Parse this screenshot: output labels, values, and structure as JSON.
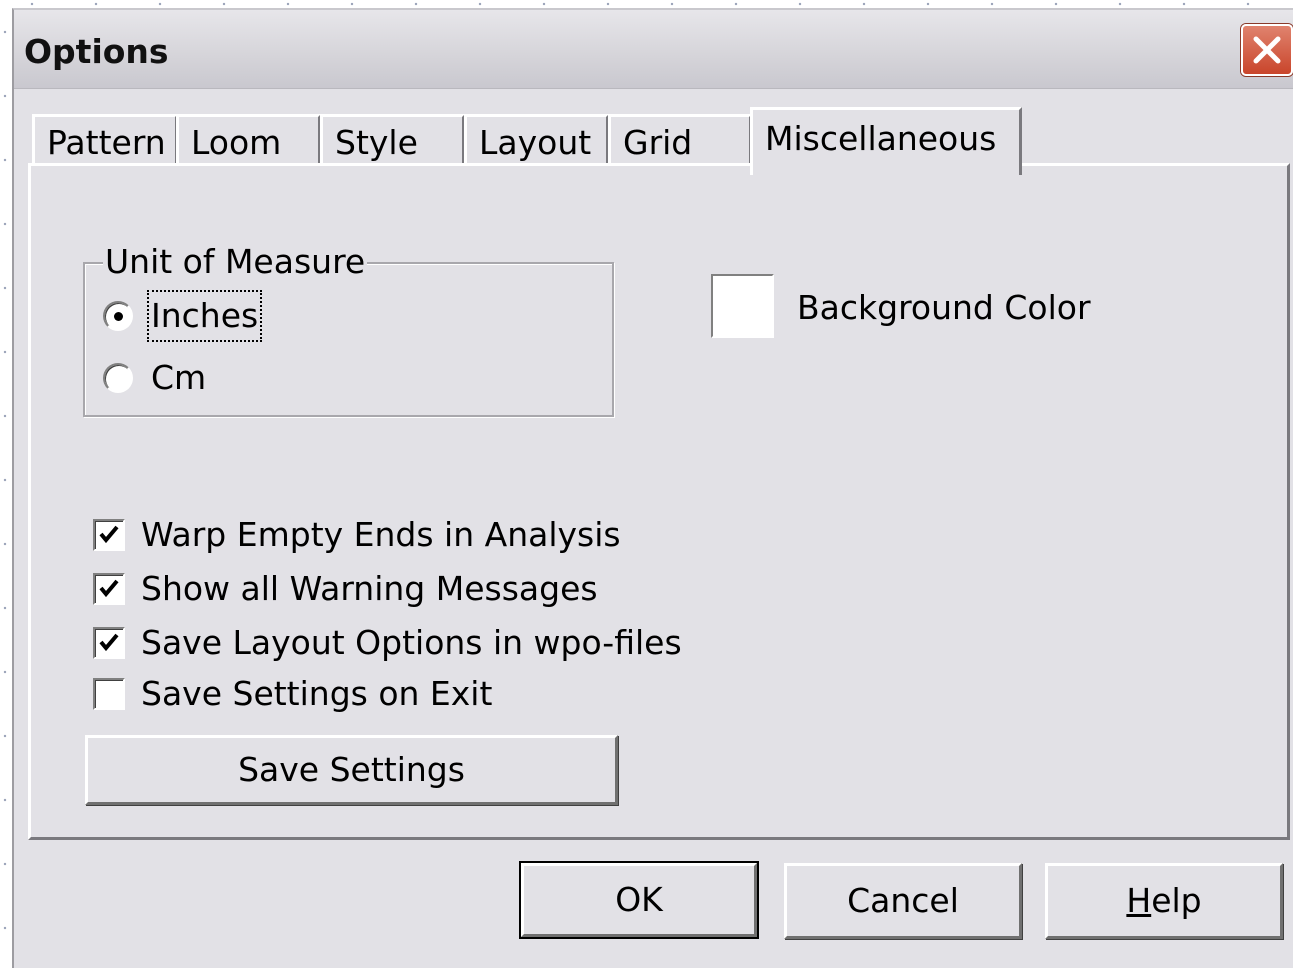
{
  "window": {
    "title": "Options"
  },
  "tabs": [
    {
      "label": "Pattern",
      "active": false
    },
    {
      "label": "Loom",
      "active": false
    },
    {
      "label": "Style",
      "active": false
    },
    {
      "label": "Layout",
      "active": false
    },
    {
      "label": "Grid",
      "active": false
    },
    {
      "label": "Miscellaneous",
      "active": true
    }
  ],
  "unit_group": {
    "legend": "Unit of Measure",
    "options": [
      {
        "label": "Inches",
        "checked": true
      },
      {
        "label": "Cm",
        "checked": false
      }
    ]
  },
  "background_color": {
    "label": "Background Color",
    "value": "#ffffff"
  },
  "checkboxes": [
    {
      "label": "Warp Empty Ends in Analysis",
      "checked": true
    },
    {
      "label": "Show all Warning Messages",
      "checked": true
    },
    {
      "label": "Save Layout Options in wpo-files",
      "checked": true
    },
    {
      "label": "Save Settings on Exit",
      "checked": false
    }
  ],
  "save_settings_label": "Save Settings",
  "buttons": {
    "ok": "OK",
    "cancel": "Cancel",
    "help_first": "H",
    "help_rest": "elp"
  },
  "colors": {
    "close_button": "#c9452b",
    "dialog_bg": "#e2e1e6"
  },
  "icons": {
    "close": "close-icon",
    "check": "checkmark-icon"
  }
}
